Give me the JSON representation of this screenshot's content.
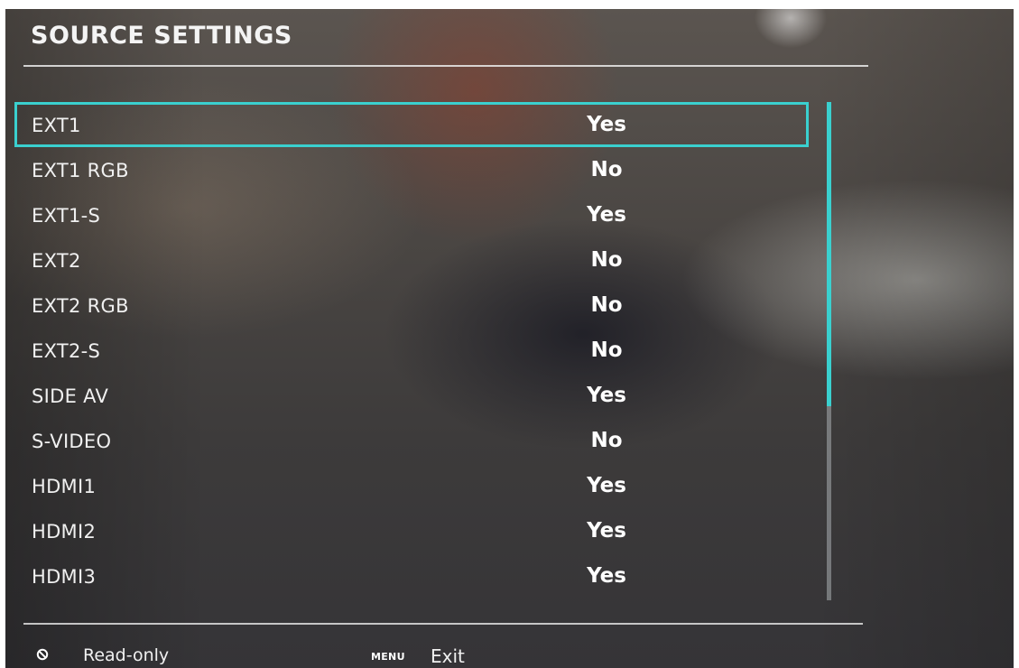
{
  "header": {
    "title": "SOURCE SETTINGS"
  },
  "sources": [
    {
      "label": "EXT1",
      "value": "Yes",
      "selected": true
    },
    {
      "label": "EXT1 RGB",
      "value": "No",
      "selected": false
    },
    {
      "label": "EXT1-S",
      "value": "Yes",
      "selected": false
    },
    {
      "label": "EXT2",
      "value": "No",
      "selected": false
    },
    {
      "label": "EXT2 RGB",
      "value": "No",
      "selected": false
    },
    {
      "label": "EXT2-S",
      "value": "No",
      "selected": false
    },
    {
      "label": "SIDE AV",
      "value": "Yes",
      "selected": false
    },
    {
      "label": "S-VIDEO",
      "value": "No",
      "selected": false
    },
    {
      "label": "HDMI1",
      "value": "Yes",
      "selected": false
    },
    {
      "label": "HDMI2",
      "value": "Yes",
      "selected": false
    },
    {
      "label": "HDMI3",
      "value": "Yes",
      "selected": false
    }
  ],
  "scrollbar": {
    "visible_fraction": 0.61
  },
  "footer": {
    "readonly_icon": "read-only-icon",
    "readonly_label": "Read-only",
    "menu_key": "MENU",
    "exit_label": "Exit"
  },
  "colors": {
    "accent": "#3ad0cf"
  }
}
